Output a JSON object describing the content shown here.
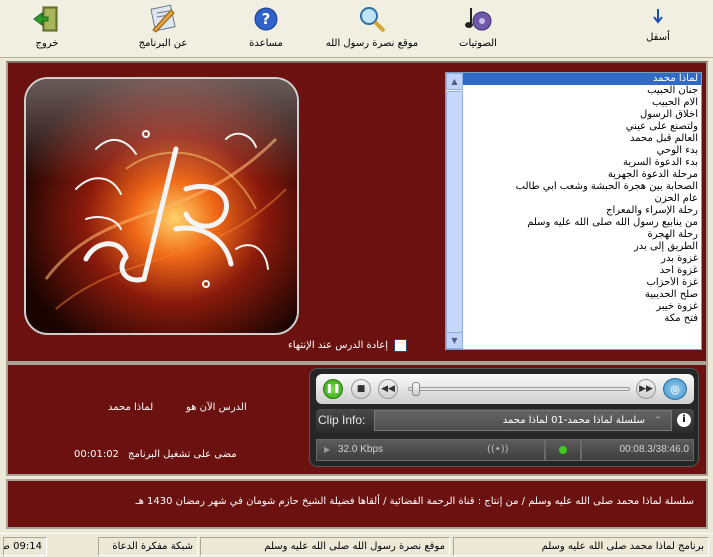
{
  "toolbar": {
    "buttons": [
      {
        "id": "exit",
        "label": "خروج",
        "icon": "exit-door-icon"
      },
      {
        "id": "about",
        "label": "عن البرنامج",
        "icon": "about-tools-icon"
      },
      {
        "id": "help",
        "label": "مساعدة",
        "icon": "help-icon"
      },
      {
        "id": "website",
        "label": "موقع نصرة رسول الله",
        "icon": "search-globe-icon"
      },
      {
        "id": "audio",
        "label": "الصوتيات",
        "icon": "music-note-icon"
      },
      {
        "id": "bottom",
        "label": "أسفل",
        "icon": "arrow-down-icon"
      }
    ]
  },
  "lessons": {
    "items": [
      "لماذا محمد",
      "جنان الحبيب",
      "آلام الحبيب",
      "أخلاق الرسول",
      "ولتصنع على عيني",
      "العالم قبل محمد",
      "بدء الوحي",
      "بدء الدعوة السرية",
      "مرحلة الدعوة الجهرية",
      "الصحابة بين هجرة الحبشة وشعب أبي طالب",
      "عام الحزن",
      "رحلة الإسراء والمعراج",
      "من ينابيع رسول الله صلى الله عليه وسلم",
      "رحلة الهجرة",
      "الطريق إلى بدر",
      "غزوة بدر",
      "غزوة أحد",
      "غزة الأحزاب",
      "صلح الحديبية",
      "غزوة خيبر",
      "فتح مكة"
    ],
    "selected_index": 0
  },
  "repeat_option": {
    "label": "إعادة الدرس عند الإنتهاء",
    "checked": false
  },
  "now_playing": {
    "label": "الدرس الآن هو",
    "lesson": "لماذا محمد",
    "elapsed_label": "مضى على تشغيل البرنامج",
    "elapsed_value": "00:01:02"
  },
  "player": {
    "position_fraction": 0.004,
    "clip_label": "Clip Info:",
    "clip_text": "سلسلة لماذا محمد-01 لماذا محمد",
    "bitrate": "32.0 Kbps",
    "time": "00:08.3/38:46.0"
  },
  "credits": "سلسلة لماذا محمد صلى الله عليه وسلم / من إنتاج : قناة الرحمة الفضائية / ألقاها فضيلة الشيخ حازم شومان في شهر رمضان 1430 هـ",
  "statusbar": {
    "app_name": "برنامج لماذا محمد صلى الله عليه وسلم",
    "site": "موقع نصرة رسول الله صلى الله عليه وسلم",
    "network": "شبكة مفكرة الدعاة",
    "clock": "09:14 ص"
  },
  "colors": {
    "panel": "#6b1210",
    "selection": "#316ac5",
    "play": "#3fcc1f"
  }
}
